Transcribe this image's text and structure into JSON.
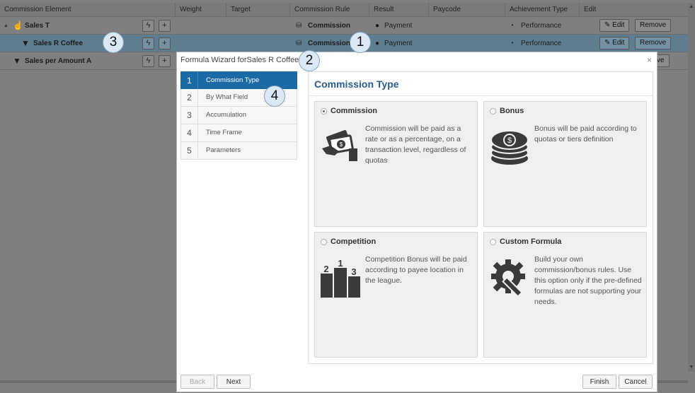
{
  "grid": {
    "columns": [
      "Commission Element",
      "Weight",
      "Target",
      "Commission Rule",
      "Result",
      "Paycode",
      "Achievement Type",
      "Edit"
    ],
    "rows": [
      {
        "element": "Sales T",
        "rule": "Commission",
        "result": "Payment",
        "achievement": "Performance",
        "edit_label": "Edit",
        "remove_label": "Remove",
        "expander": "▲",
        "selected": false
      },
      {
        "element": "Sales R Coffee",
        "rule": "Commission",
        "result": "Payment",
        "achievement": "Performance",
        "edit_label": "Edit",
        "remove_label": "Remove",
        "selected": true
      },
      {
        "element": "Sales per Amount A",
        "remove_label": "ve",
        "selected": false
      }
    ]
  },
  "badges": [
    "1",
    "2",
    "3",
    "4"
  ],
  "dialog": {
    "title": "Formula Wizard forSales R Coffee",
    "close": "×",
    "steps": [
      {
        "num": "1",
        "label": "Commission Type",
        "active": true
      },
      {
        "num": "2",
        "label": "By What Field",
        "active": false
      },
      {
        "num": "3",
        "label": "Accumulation",
        "active": false
      },
      {
        "num": "4",
        "label": "Time Frame",
        "active": false
      },
      {
        "num": "5",
        "label": "Parameters",
        "active": false
      }
    ],
    "panel_title": "Commission Type",
    "options": [
      {
        "title": "Commission",
        "selected": true,
        "icon": "money-hand-icon",
        "desc": "Commission will be paid as a rate or as a percentage, on a transaction level, regardless of quotas"
      },
      {
        "title": "Bonus",
        "selected": false,
        "icon": "coin-stack-icon",
        "desc": "Bonus will be paid according to quotas or tiers definition"
      },
      {
        "title": "Competition",
        "selected": false,
        "icon": "podium-icon",
        "desc": "Competition Bonus will be paid according to payee location in the league."
      },
      {
        "title": "Custom Formula",
        "selected": false,
        "icon": "gear-wrench-icon",
        "desc": "Build your own commission/bonus rules. Use this option only if the pre-defined formulas are not supporting your needs."
      }
    ],
    "buttons": {
      "back": "Back",
      "next": "Next",
      "finish": "Finish",
      "cancel": "Cancel"
    }
  }
}
